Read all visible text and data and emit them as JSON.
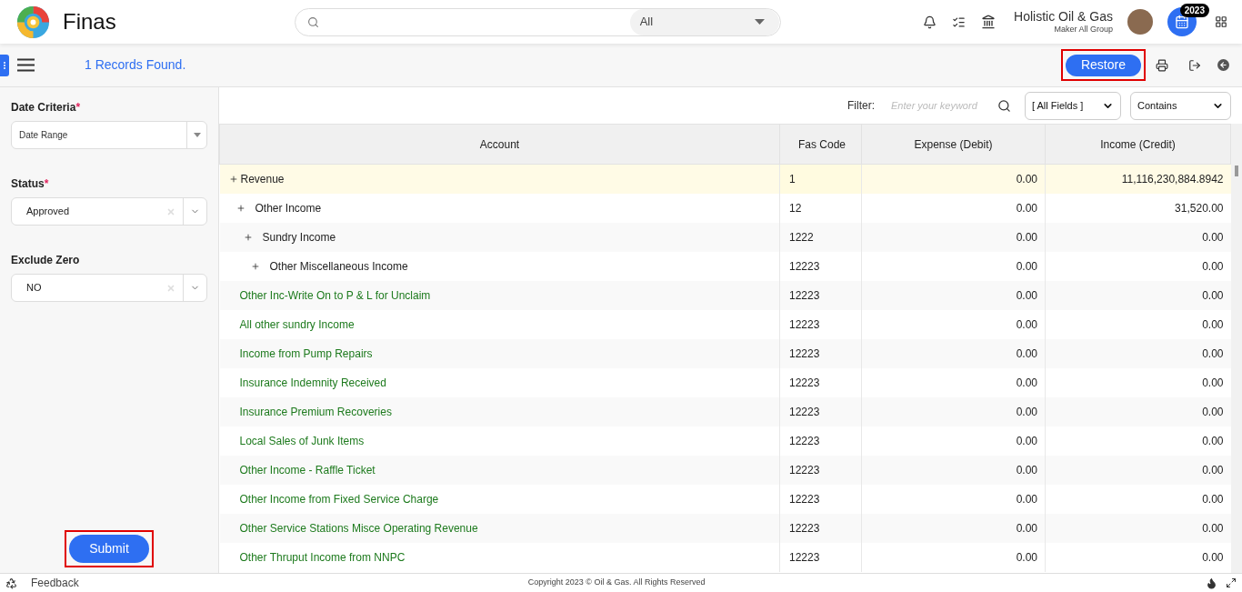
{
  "header": {
    "brand": "Finas",
    "search": {
      "scope": "All"
    },
    "company": "Holistic Oil & Gas",
    "group": "Maker All Group",
    "year_badge": "2023"
  },
  "toolbar": {
    "records": "1 Records Found.",
    "restore": "Restore",
    "restore_highlighted": true
  },
  "sidebar": {
    "fields": [
      {
        "label": "Date Criteria",
        "required_mark": "*",
        "value": "Date Range",
        "kind": "dropdown"
      },
      {
        "label": "Status",
        "required_mark": "*",
        "value": "Approved",
        "kind": "clearable"
      },
      {
        "label": "Exclude Zero",
        "value": "NO",
        "kind": "clearable"
      }
    ],
    "submit": "Submit",
    "submit_highlighted": true
  },
  "filter": {
    "label": "Filter:",
    "placeholder": "Enter your keyword",
    "field": "[ All Fields ]",
    "operator": "Contains"
  },
  "table": {
    "columns": [
      "Account",
      "Fas Code",
      "Expense (Debit)",
      "Income (Credit)"
    ],
    "rows": [
      {
        "account": "Revenue",
        "code": "1",
        "debit": "0.00",
        "credit": "11,116,230,884.8942",
        "selected": true,
        "children": [
          {
            "account": "Other Income",
            "code": "12",
            "debit": "0.00",
            "credit": "31,520.00",
            "selected": false,
            "children": [
              {
                "account": "Sundry Income",
                "code": "1222",
                "debit": "0.00",
                "credit": "0.00",
                "selected": false,
                "children": [
                  {
                    "account": "Other Miscellaneous Income",
                    "code": "12223",
                    "debit": "0.00",
                    "credit": "0.00",
                    "selected": false,
                    "children": [
                      {
                        "account": "Other Inc-Write On to P & L for Unclaim",
                        "code": "12223",
                        "debit": "0.00",
                        "credit": "0.00",
                        "selected": false
                      },
                      {
                        "account": "All other sundry Income",
                        "code": "12223",
                        "debit": "0.00",
                        "credit": "0.00",
                        "selected": false
                      },
                      {
                        "account": "Income from Pump Repairs",
                        "code": "12223",
                        "debit": "0.00",
                        "credit": "0.00",
                        "selected": false
                      },
                      {
                        "account": "Insurance Indemnity Received",
                        "code": "12223",
                        "debit": "0.00",
                        "credit": "0.00",
                        "selected": false
                      },
                      {
                        "account": "Insurance Premium Recoveries",
                        "code": "12223",
                        "debit": "0.00",
                        "credit": "0.00",
                        "selected": false
                      },
                      {
                        "account": "Local Sales of Junk Items",
                        "code": "12223",
                        "debit": "0.00",
                        "credit": "0.00",
                        "selected": false
                      },
                      {
                        "account": "Other Income - Raffle Ticket",
                        "code": "12223",
                        "debit": "0.00",
                        "credit": "0.00",
                        "selected": false
                      },
                      {
                        "account": "Other Income from Fixed Service Charge",
                        "code": "12223",
                        "debit": "0.00",
                        "credit": "0.00",
                        "selected": false
                      },
                      {
                        "account": "Other Service Stations Misce Operating Revenue",
                        "code": "12223",
                        "debit": "0.00",
                        "credit": "0.00",
                        "selected": false
                      },
                      {
                        "account": "Other Thruput Income from NNPC",
                        "code": "12223",
                        "debit": "0.00",
                        "credit": "0.00",
                        "selected": false
                      }
                    ]
                  }
                ]
              }
            ]
          }
        ]
      }
    ]
  },
  "footer": {
    "feedback": "Feedback",
    "copyright": "Copyright 2023 © Oil & Gas. All Rights Reserved"
  }
}
